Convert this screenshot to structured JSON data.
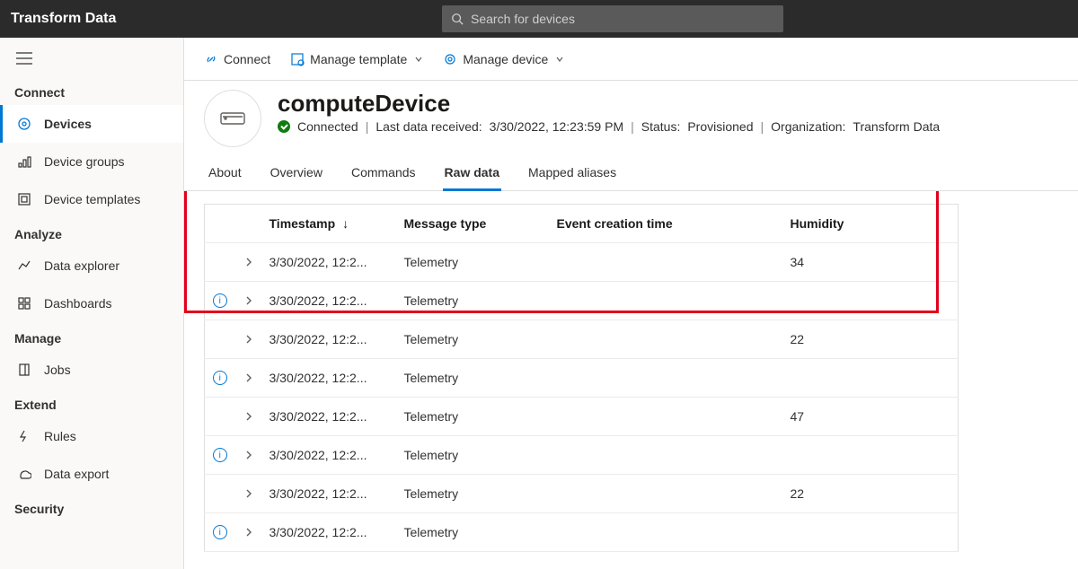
{
  "app": {
    "title": "Transform Data"
  },
  "search": {
    "placeholder": "Search for devices"
  },
  "sidebar": {
    "sections": [
      {
        "label": "Connect",
        "items": [
          {
            "name": "devices",
            "label": "Devices",
            "active": true
          },
          {
            "name": "device-groups",
            "label": "Device groups"
          },
          {
            "name": "device-templates",
            "label": "Device templates"
          }
        ]
      },
      {
        "label": "Analyze",
        "items": [
          {
            "name": "data-explorer",
            "label": "Data explorer"
          },
          {
            "name": "dashboards",
            "label": "Dashboards"
          }
        ]
      },
      {
        "label": "Manage",
        "items": [
          {
            "name": "jobs",
            "label": "Jobs"
          }
        ]
      },
      {
        "label": "Extend",
        "items": [
          {
            "name": "rules",
            "label": "Rules"
          },
          {
            "name": "data-export",
            "label": "Data export"
          }
        ]
      },
      {
        "label": "Security",
        "items": []
      }
    ]
  },
  "toolbar": {
    "connect": "Connect",
    "manage_template": "Manage template",
    "manage_device": "Manage device"
  },
  "device": {
    "name": "computeDevice",
    "status_label": "Connected",
    "last_data_label": "Last data received:",
    "last_data_value": "3/30/2022, 12:23:59 PM",
    "status_name_label": "Status:",
    "status_name_value": "Provisioned",
    "org_label": "Organization:",
    "org_value": "Transform Data"
  },
  "tabs": [
    {
      "label": "About"
    },
    {
      "label": "Overview"
    },
    {
      "label": "Commands"
    },
    {
      "label": "Raw data",
      "active": true
    },
    {
      "label": "Mapped aliases"
    }
  ],
  "table": {
    "columns": {
      "timestamp": "Timestamp",
      "message_type": "Message type",
      "event_creation": "Event creation time",
      "humidity": "Humidity"
    },
    "rows": [
      {
        "info": false,
        "ts": "3/30/2022, 12:2...",
        "type": "Telemetry",
        "evt": "",
        "hum": "34"
      },
      {
        "info": true,
        "ts": "3/30/2022, 12:2...",
        "type": "Telemetry",
        "evt": "",
        "hum": ""
      },
      {
        "info": false,
        "ts": "3/30/2022, 12:2...",
        "type": "Telemetry",
        "evt": "",
        "hum": "22"
      },
      {
        "info": true,
        "ts": "3/30/2022, 12:2...",
        "type": "Telemetry",
        "evt": "",
        "hum": ""
      },
      {
        "info": false,
        "ts": "3/30/2022, 12:2...",
        "type": "Telemetry",
        "evt": "",
        "hum": "47"
      },
      {
        "info": true,
        "ts": "3/30/2022, 12:2...",
        "type": "Telemetry",
        "evt": "",
        "hum": ""
      },
      {
        "info": false,
        "ts": "3/30/2022, 12:2...",
        "type": "Telemetry",
        "evt": "",
        "hum": "22"
      },
      {
        "info": true,
        "ts": "3/30/2022, 12:2...",
        "type": "Telemetry",
        "evt": "",
        "hum": ""
      }
    ]
  }
}
